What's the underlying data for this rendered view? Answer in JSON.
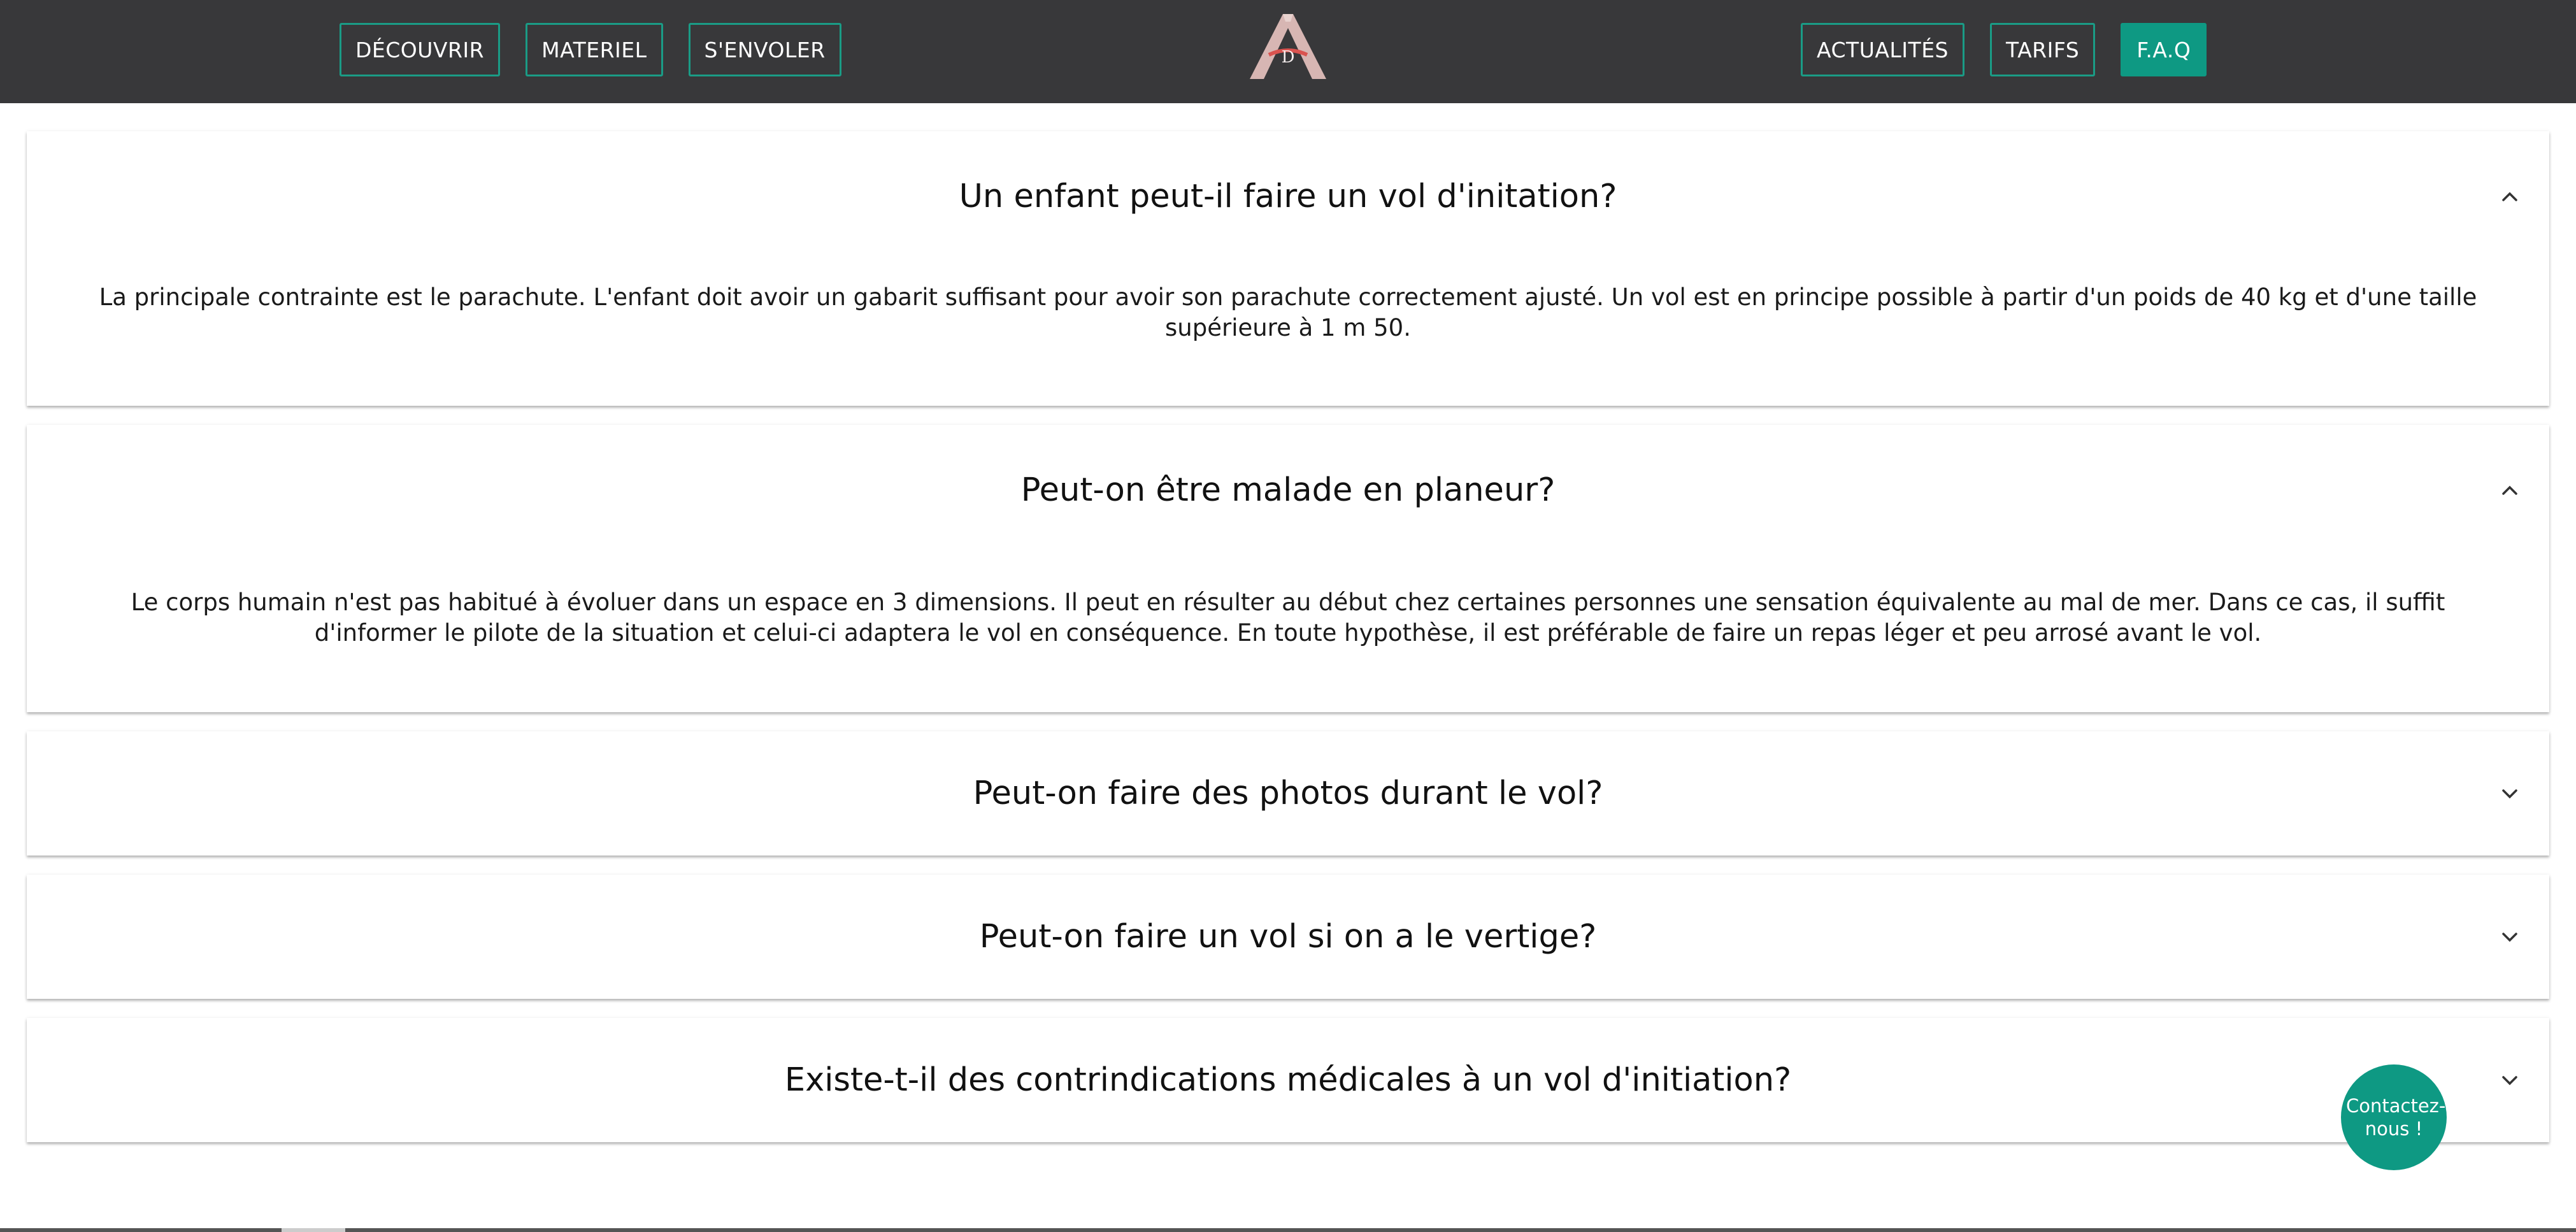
{
  "nav": {
    "left": [
      "DÉCOUVRIR",
      "MATERIEL",
      "S'ENVOLER"
    ],
    "right": [
      "ACTUALITÉS",
      "TARIFS",
      "F.A.Q"
    ],
    "active": "F.A.Q",
    "logo_letters": "A D"
  },
  "faq": [
    {
      "question": "Un enfant peut-il faire un vol d'initation?",
      "expanded": true,
      "answer": "La principale contrainte est le parachute. L'enfant doit avoir un gabarit suffisant pour avoir son parachute correctement ajusté. Un vol est en principe possible à partir d'un poids de 40 kg et d'une taille supérieure à 1 m 50."
    },
    {
      "question": "Peut-on être malade en planeur?",
      "expanded": true,
      "answer": "Le corps humain n'est pas habitué à évoluer dans un espace en 3 dimensions. Il peut en résulter au début chez certaines personnes une sensation équivalente au mal de mer. Dans ce cas, il suffit d'informer le pilote de la situation et celui-ci adaptera le vol en conséquence. En toute hypothèse, il est préférable de faire un repas léger et peu arrosé avant le vol."
    },
    {
      "question": "Peut-on faire des photos durant le vol?",
      "expanded": false
    },
    {
      "question": "Peut-on faire un vol si on a le vertige?",
      "expanded": false
    },
    {
      "question": "Existe-t-il des contrindications médicales à un vol d'initiation?",
      "expanded": false
    }
  ],
  "contact_label": "Contactez-nous !",
  "colors": {
    "navbar": "#38383a",
    "accent": "#0e9983",
    "border": "#1a9c86"
  },
  "icons": {
    "expanded": "chevron-up-icon",
    "collapsed": "chevron-down-icon"
  }
}
